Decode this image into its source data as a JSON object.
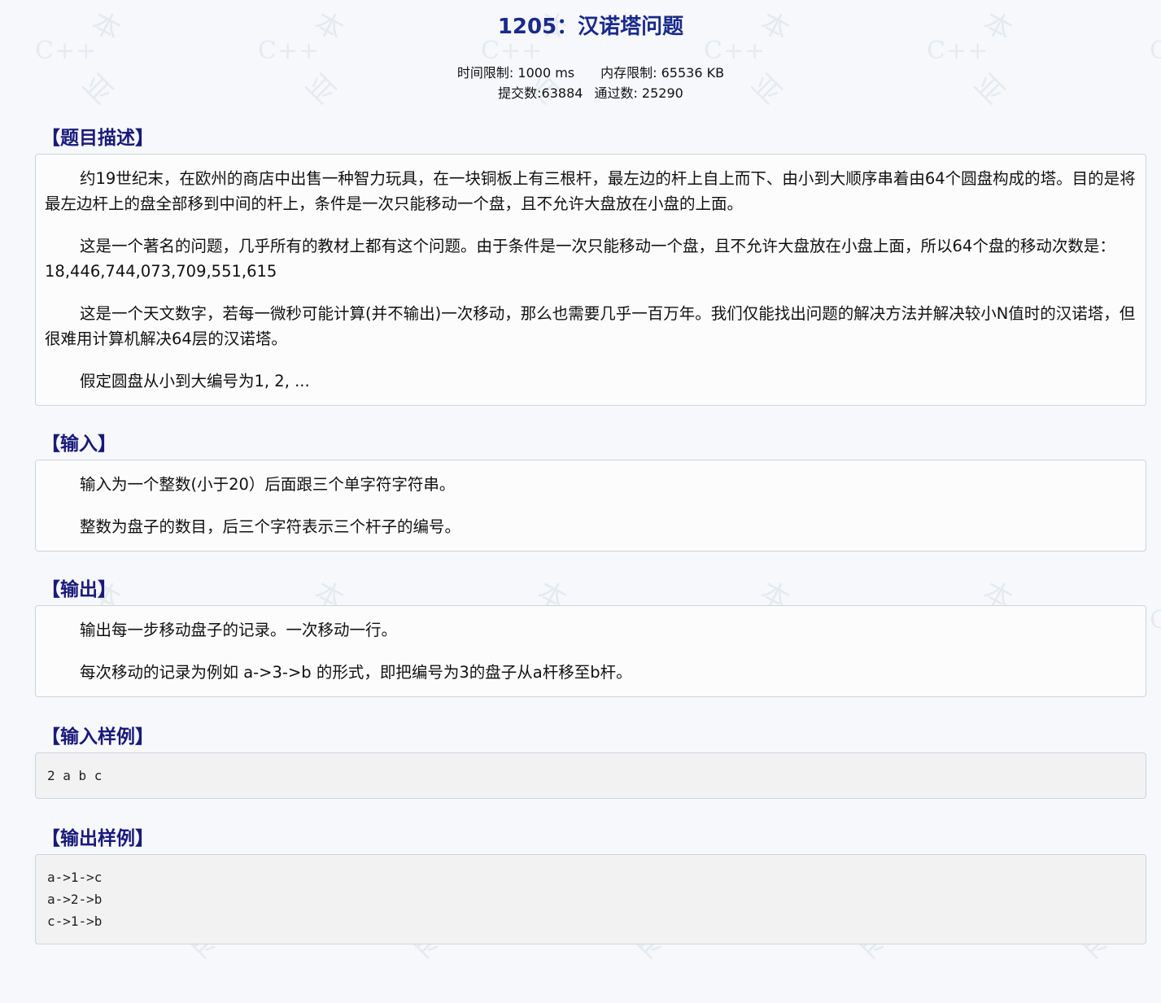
{
  "problem": {
    "title": "1205：汉诺塔问题",
    "time_limit": "时间限制: 1000 ms",
    "memory_limit": "内存限制: 65536 KB",
    "submissions": "提交数:63884",
    "accepted": "通过数: 25290"
  },
  "description": {
    "heading": "【题目描述】",
    "paragraphs": [
      "约19世纪末，在欧州的商店中出售一种智力玩具，在一块铜板上有三根杆，最左边的杆上自上而下、由小到大顺序串着由64个圆盘构成的塔。目的是将最左边杆上的盘全部移到中间的杆上，条件是一次只能移动一个盘，且不允许大盘放在小盘的上面。",
      "这是一个著名的问题，几乎所有的教材上都有这个问题。由于条件是一次只能移动一个盘，且不允许大盘放在小盘上面，所以64个盘的移动次数是：18,446,744,073,709,551,615",
      "这是一个天文数字，若每一微秒可能计算(并不输出)一次移动，那么也需要几乎一百万年。我们仅能找出问题的解决方法并解决较小N值时的汉诺塔，但很难用计算机解决64层的汉诺塔。",
      "假定圆盘从小到大编号为1, 2, ..."
    ]
  },
  "input": {
    "heading": "【输入】",
    "paragraphs": [
      "输入为一个整数(小于20）后面跟三个单字符字符串。",
      "整数为盘子的数目，后三个字符表示三个杆子的编号。"
    ]
  },
  "output": {
    "heading": "【输出】",
    "paragraphs": [
      "输出每一步移动盘子的记录。一次移动一行。",
      "每次移动的记录为例如 a->3->b 的形式，即把编号为3的盘子从a杆移至b杆。"
    ]
  },
  "sample_input": {
    "heading": "【输入样例】",
    "code": "2 a b c"
  },
  "sample_output": {
    "heading": "【输出样例】",
    "code": "a->1->c\na->2->b\nc->1->b"
  },
  "watermark": {
    "text": "C++",
    "char1": "本",
    "char2": "亚"
  }
}
